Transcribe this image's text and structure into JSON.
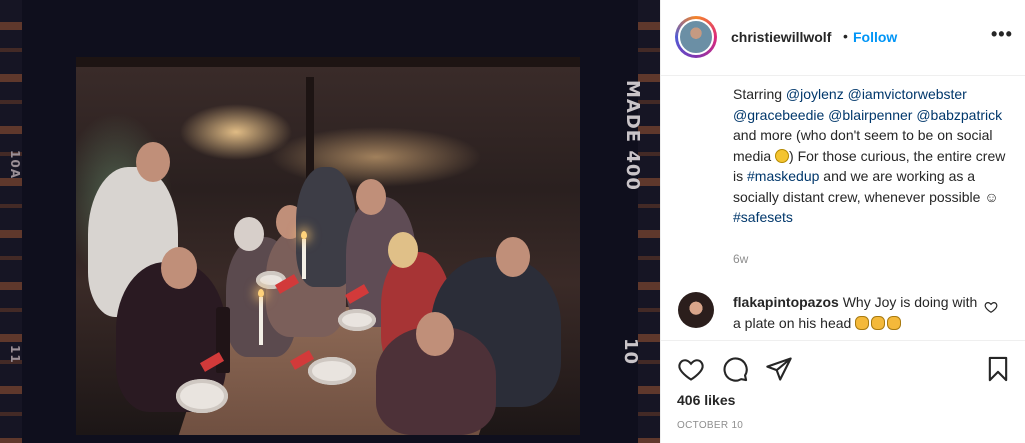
{
  "post": {
    "film_label": "MADE 400",
    "film_frame_number": "10",
    "film_left_top": "10A",
    "film_left_bottom": "11",
    "username": "christiewillwolf",
    "separator": "•",
    "follow_label": "Follow",
    "more_label": "•••",
    "caption": {
      "starring": "Starring",
      "m1": "@joylenz",
      "m2": "@iamvictorwebster",
      "m3": "@gracebeedie",
      "m4": "@blairpenner",
      "m5": "@babzpatrick",
      "t1": "and more (who don't seem to be on social media",
      "t2": ") For those curious, the entire crew is",
      "tag1": "#maskedup",
      "t3": "and we are working as a socially distant crew, whenever possible",
      "smiley": "☺",
      "tag2": "#safesets",
      "time": "6w"
    },
    "comment": {
      "user": "flakapintopazos",
      "text": "Why Joy is doing with a plate on his head"
    },
    "likes": "406 likes",
    "date": "OCTOBER 10"
  },
  "icons": {
    "like": "heart-icon",
    "comment": "comment-icon",
    "share": "paper-plane-icon",
    "save": "bookmark-icon",
    "comment_like": "small-heart-icon"
  },
  "colors": {
    "link": "#00376b",
    "follow": "#0095f6",
    "text": "#262626",
    "muted": "#8e8e8e",
    "border": "#efefef"
  }
}
